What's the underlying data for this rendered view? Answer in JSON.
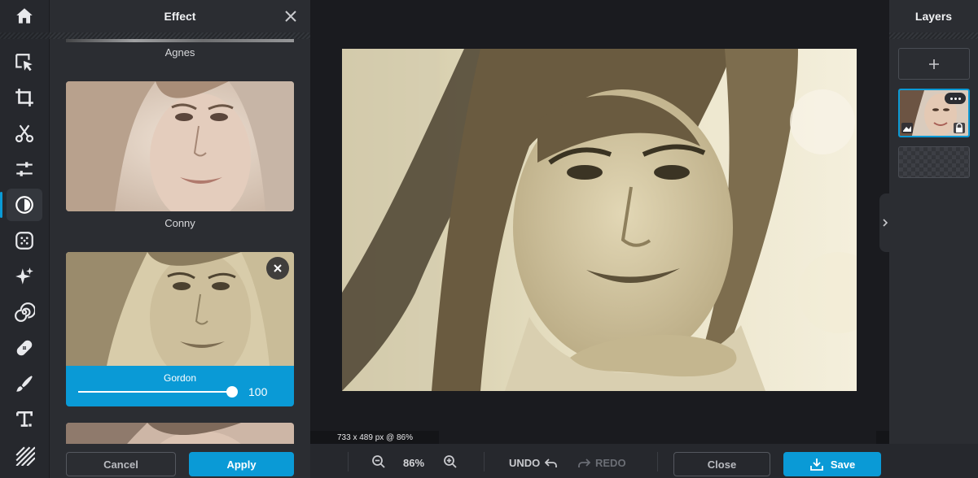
{
  "effect_panel": {
    "title": "Effect",
    "effects": [
      {
        "name": "Agnes"
      },
      {
        "name": "Conny"
      },
      {
        "name": "Gordon",
        "intensity": 100
      }
    ],
    "selected": {
      "name": "Gordon",
      "intensity_label": "100"
    },
    "cancel_label": "Cancel",
    "apply_label": "Apply"
  },
  "canvas": {
    "dimensions_label": "733 x 489 px @ 86%"
  },
  "bottom_bar": {
    "zoom_label": "86%",
    "undo_label": "UNDO",
    "redo_label": "REDO",
    "close_label": "Close",
    "save_label": "Save"
  },
  "layers_panel": {
    "title": "Layers"
  },
  "toolbar": {
    "tools": [
      "home-icon",
      "arrange-icon",
      "crop-icon",
      "cut-icon",
      "adjust-icon",
      "effect-icon",
      "texture-icon",
      "sparkle-icon",
      "spiral-icon",
      "bandaid-icon",
      "brush-icon",
      "text-icon",
      "stripes-icon"
    ],
    "active": "effect-icon"
  },
  "colors": {
    "accent": "#0a9ad6",
    "panel": "#2b2d32",
    "background": "#1a1b1f"
  }
}
